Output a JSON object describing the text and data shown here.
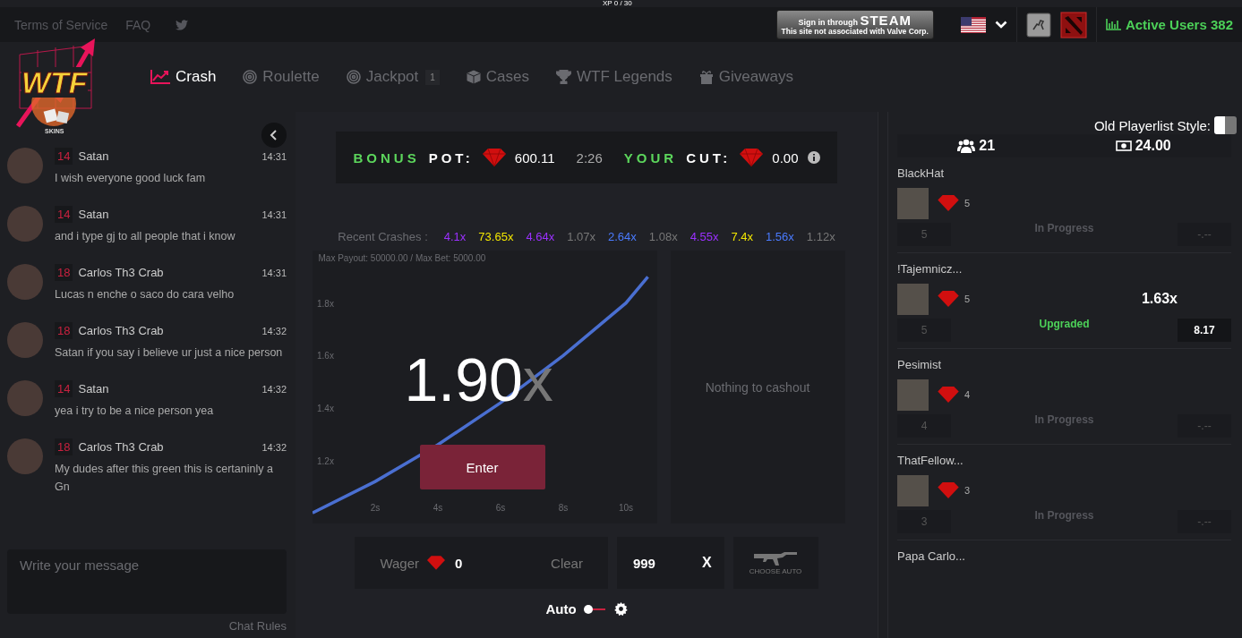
{
  "xp": "XP 0 / 30",
  "top_links": [
    "Terms of Service",
    "FAQ"
  ],
  "steam": {
    "line1": "Sign in through",
    "brand": "STEAM",
    "line2": "This site not associated with Valve Corp."
  },
  "active_users": "Active Users 382",
  "logo": {
    "title": "WTF",
    "subtitle": "SKINS"
  },
  "tabs": [
    {
      "label": "Crash",
      "selected": true
    },
    {
      "label": "Roulette",
      "selected": false
    },
    {
      "label": "Jackpot",
      "selected": false,
      "badge": "1"
    },
    {
      "label": "Cases",
      "selected": false
    },
    {
      "label": "WTF Legends",
      "selected": false
    },
    {
      "label": "Giveaways",
      "selected": false
    }
  ],
  "chat": {
    "messages": [
      {
        "level": "14",
        "name": "Satan",
        "time": "14:31",
        "text": "I wish everyone good luck fam"
      },
      {
        "level": "14",
        "name": "Satan",
        "time": "14:31",
        "text": "and i type gj to all people that i know"
      },
      {
        "level": "18",
        "name": "Carlos Th3 Crab",
        "time": "14:31",
        "text": "Lucas n enche o saco do cara velho"
      },
      {
        "level": "18",
        "name": "Carlos Th3 Crab",
        "time": "14:32",
        "text": "Satan if you say i believe ur just a nice person"
      },
      {
        "level": "14",
        "name": "Satan",
        "time": "14:32",
        "text": "yea i try to be a nice person yea"
      },
      {
        "level": "18",
        "name": "Carlos Th3 Crab",
        "time": "14:32",
        "text": "My dudes after this green this is certaninly a Gn"
      }
    ],
    "placeholder": "Write your message",
    "rules": "Chat Rules"
  },
  "bonus": {
    "word1": "BONUS",
    "word2": "POT:",
    "pot": "600.11",
    "timer": "2:26",
    "word3": "YOUR",
    "word4": "CUT:",
    "cut": "0.00"
  },
  "recent_label": "Recent Crashes :",
  "recent_crashes": [
    {
      "value": "4.1x",
      "color": "#9b30ff"
    },
    {
      "value": "73.65x",
      "color": "#f2e600"
    },
    {
      "value": "4.64x",
      "color": "#9b30ff"
    },
    {
      "value": "1.07x",
      "color": "#777777"
    },
    {
      "value": "2.64x",
      "color": "#4a7bff"
    },
    {
      "value": "1.08x",
      "color": "#777777"
    },
    {
      "value": "4.55x",
      "color": "#9b30ff"
    },
    {
      "value": "7.4x",
      "color": "#f2e600"
    },
    {
      "value": "1.56x",
      "color": "#4a7bff"
    },
    {
      "value": "1.12x",
      "color": "#777777"
    }
  ],
  "game": {
    "limits": "Max Payout: 50000.00 / Max Bet: 5000.00",
    "multiplier": "1.90",
    "suffix": "x",
    "enter": "Enter",
    "cashout": "Nothing to cashout",
    "chart_data": {
      "type": "line",
      "x": [
        0,
        2,
        4,
        6,
        8,
        10,
        10.7
      ],
      "xlim": [
        0,
        11
      ],
      "ylim": [
        0.96,
        2.0
      ],
      "series": [
        {
          "color": "#4a6fd1",
          "values": [
            1.0,
            1.12,
            1.26,
            1.42,
            1.6,
            1.8,
            1.9
          ]
        }
      ],
      "xticks": [
        {
          "value": 2,
          "label": "2s"
        },
        {
          "value": 4,
          "label": "4s"
        },
        {
          "value": 6,
          "label": "6s"
        },
        {
          "value": 8,
          "label": "8s"
        },
        {
          "value": 10,
          "label": "10s"
        }
      ],
      "yticks": [
        {
          "value": 1.2,
          "label": "1.2x"
        },
        {
          "value": 1.4,
          "label": "1.4x"
        },
        {
          "value": 1.6,
          "label": "1.6x"
        },
        {
          "value": 1.8,
          "label": "1.8x"
        }
      ]
    }
  },
  "bet": {
    "label": "Wager",
    "value": "0",
    "clear": "Clear",
    "auto_cashout": "999",
    "x": "X",
    "choose": "CHOOSE AUTO",
    "auto_label": "Auto",
    "auto_on": false
  },
  "players_panel": {
    "toggle_label": "Old Playerlist Style:",
    "toggle_on": false,
    "count": "21",
    "total": "24.00"
  },
  "players": [
    {
      "name": "BlackHat",
      "gems": "5",
      "bet": "5",
      "status": "In Progress",
      "color": "#55565c",
      "cashout": "-.--"
    },
    {
      "name": "!Tajemnicz...",
      "gems": "5",
      "multiplier": "1.63x",
      "bet": "5",
      "status": "Upgraded",
      "color": "#4cd058",
      "cashout": "8.17"
    },
    {
      "name": "Pesimist",
      "gems": "4",
      "bet": "4",
      "status": "In Progress",
      "color": "#55565c",
      "cashout": "-.--"
    },
    {
      "name": "ThatFellow...",
      "gems": "3",
      "bet": "3",
      "status": "In Progress",
      "color": "#55565c",
      "cashout": "-.--"
    },
    {
      "name": "Papa Carlo..."
    }
  ]
}
